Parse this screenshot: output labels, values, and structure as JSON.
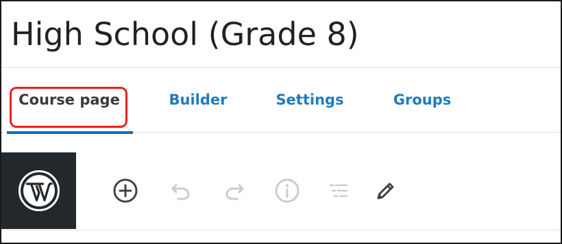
{
  "page": {
    "title": "High School (Grade 8)"
  },
  "tabs": [
    {
      "label": "Course page",
      "active": true,
      "highlighted": true
    },
    {
      "label": "Builder",
      "active": false
    },
    {
      "label": "Settings",
      "active": false
    },
    {
      "label": "Groups",
      "active": false
    }
  ],
  "toolbar": {
    "logo": "wordpress-icon",
    "tools": [
      {
        "name": "add-block-icon",
        "enabled": true
      },
      {
        "name": "undo-icon",
        "enabled": false
      },
      {
        "name": "redo-icon",
        "enabled": false
      },
      {
        "name": "info-icon",
        "enabled": false
      },
      {
        "name": "outline-icon",
        "enabled": false
      },
      {
        "name": "pencil-icon",
        "enabled": true
      }
    ]
  },
  "colors": {
    "tab_link": "#1f7bbf",
    "active_underline": "#0f6fb5",
    "highlight_box": "#e2231a",
    "wp_block_bg": "#23282d",
    "icon_enabled": "#3c434a",
    "icon_disabled": "#c9ccce"
  }
}
